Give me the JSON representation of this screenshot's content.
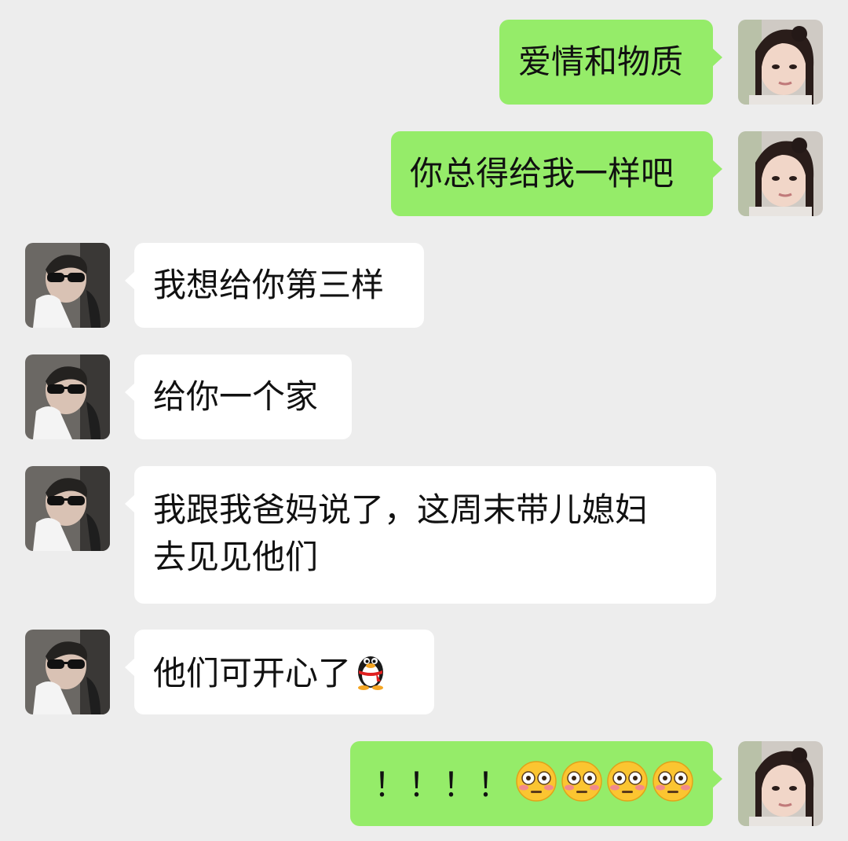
{
  "colors": {
    "background": "#ededed",
    "sent_bubble": "#95ec69",
    "received_bubble": "#ffffff"
  },
  "messages": [
    {
      "side": "sent",
      "text": "爱情和物质"
    },
    {
      "side": "sent",
      "text": "你总得给我一样吧"
    },
    {
      "side": "received",
      "text": "我想给你第三样"
    },
    {
      "side": "received",
      "text": "给你一个家"
    },
    {
      "side": "received",
      "line1": "我跟我爸妈说了，这周末带儿媳妇",
      "line2": "去见见他们"
    },
    {
      "side": "received",
      "text": "他们可开心了",
      "emoji": "qq-penguin-icon"
    },
    {
      "side": "sent",
      "text": "！！！！",
      "emoji": "flushed-face-icon",
      "emoji_count": 4
    }
  ]
}
